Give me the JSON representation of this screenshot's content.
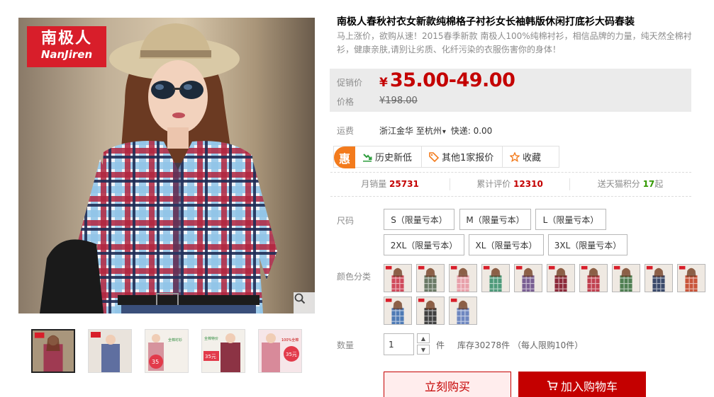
{
  "brand": {
    "cn": "南极人",
    "en": "NanJiren"
  },
  "product": {
    "title": "南极人春秋衬衣女新款纯棉格子衬衫女长袖韩版休闲打底衫大码春装",
    "subtitle": "马上涨价，欲购从速！2015春季新款 南极人100%纯棉衬衫，相信品牌的力量，纯天然全棉衬衫，健康亲肤,请别让劣质、化纤污染的衣服伤害你的身体！"
  },
  "price": {
    "promo_label": "促销价",
    "currency": "¥",
    "promo": "35.00-49.00",
    "orig_label": "价格",
    "original": "¥198.00"
  },
  "shipping": {
    "label": "运费",
    "from": "浙江金华",
    "to": "至杭州",
    "method": "快递: 0.00"
  },
  "tools": {
    "badge": "惠",
    "history": "历史新低",
    "other_price": "其他1家报价",
    "favorite": "收藏"
  },
  "stats": {
    "monthly_label": "月销量",
    "monthly_value": "25731",
    "reviews_label": "累计评价",
    "reviews_value": "12310",
    "points_label": "送天猫积分",
    "points_value": "17",
    "points_suffix": "起"
  },
  "sizes": {
    "label": "尺码",
    "options": [
      "S（限量亏本）",
      "M（限量亏本）",
      "L（限量亏本）",
      "2XL（限量亏本）",
      "XL（限量亏本）",
      "3XL（限量亏本）"
    ]
  },
  "colors": {
    "label": "颜色分类",
    "swatches": [
      {
        "name": "red-white-plaid",
        "color": "#d04a5c"
      },
      {
        "name": "grey-green-plaid",
        "color": "#6b7a66"
      },
      {
        "name": "pink-check",
        "color": "#e8a0aa"
      },
      {
        "name": "green-check",
        "color": "#4e9a7a"
      },
      {
        "name": "purple-plaid",
        "color": "#7a5f93"
      },
      {
        "name": "dark-red-plaid",
        "color": "#8c2a3a"
      },
      {
        "name": "red-pink-plaid",
        "color": "#c0404f"
      },
      {
        "name": "green-red-plaid",
        "color": "#4f7f52"
      },
      {
        "name": "navy-plaid",
        "color": "#3b4a6b"
      },
      {
        "name": "orange-red-plaid",
        "color": "#c9553a"
      },
      {
        "name": "blue-check",
        "color": "#4f7bb5"
      },
      {
        "name": "black-white-plaid",
        "color": "#404040"
      },
      {
        "name": "blue-red-plaid",
        "color": "#6e87c0"
      }
    ]
  },
  "quantity": {
    "label": "数量",
    "value": "1",
    "unit": "件",
    "stock": "库存30278件 （每人限购10件）"
  },
  "actions": {
    "buy_now": "立刻购买",
    "add_cart": "加入购物车"
  },
  "thumb_badges": {
    "t3_promo": "全棉衬衫",
    "t3_price": "35",
    "t4_promo": "全棉特价",
    "t4_price": "35元",
    "t5_promo": "100%全棉",
    "t5_price": "35元"
  },
  "colors_accent": {
    "price_red": "#c40000",
    "brand_red": "#d81e2a",
    "badge_orange": "#f37b1d"
  }
}
